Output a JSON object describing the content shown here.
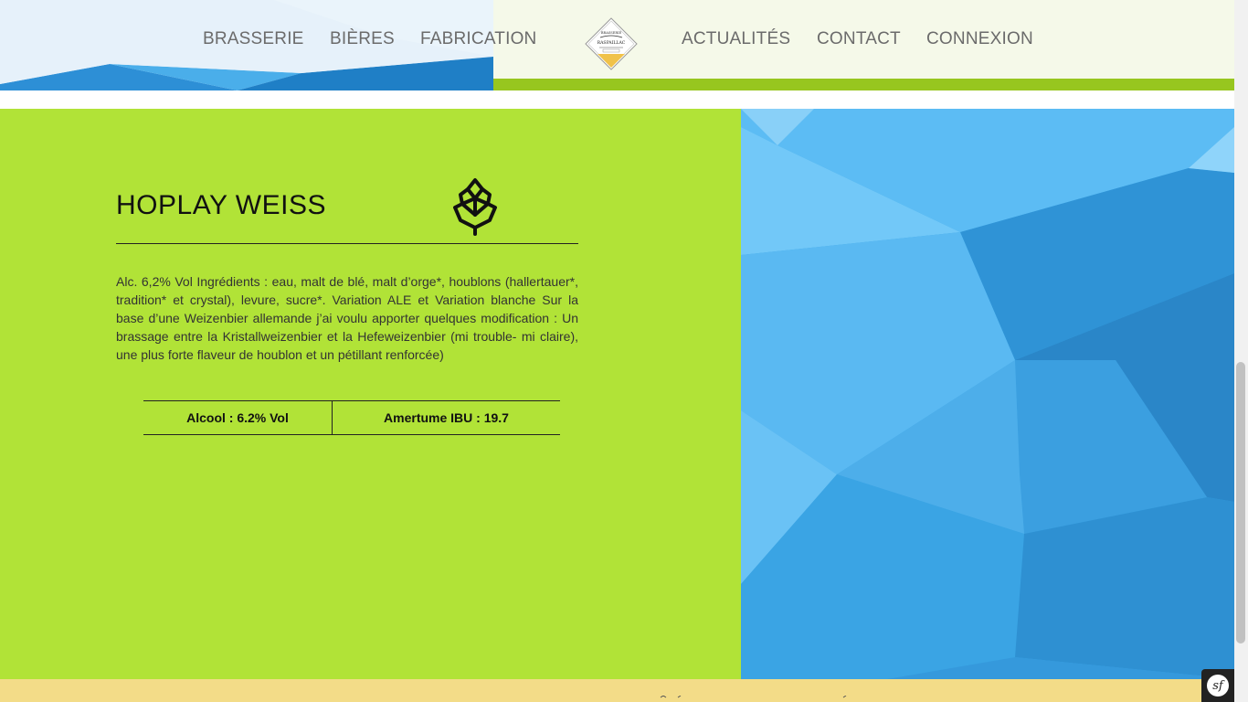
{
  "nav": {
    "left": [
      {
        "label": "BRASSERIE"
      },
      {
        "label": "BIÈRES"
      },
      {
        "label": "FABRICATION"
      }
    ],
    "right": [
      {
        "label": "ACTUALITÉS"
      },
      {
        "label": "CONTACT"
      },
      {
        "label": "CONNEXION"
      }
    ],
    "logo": {
      "line1": "BRASSERIE",
      "line2": "RASPAILLAC"
    }
  },
  "beer": {
    "name": "HOPLAY WEISS",
    "icon": "hop-icon",
    "description": "Alc. 6,2% Vol Ingrédients : eau, malt de blé, malt d’orge*, houblons (hallertauer*, tradition* et crystal), levure, sucre*. Variation ALE et Variation blanche Sur la base d’une Weizenbier allemande j’ai voulu apporter quelques modification : Un brassage entre la Kristallweizenbier et la Hefeweizenbier (mi trouble- mi claire), une plus forte flaveur de houblon et un pétillant renforcée)",
    "stats": {
      "alcohol": "Alcool : 6.2% Vol",
      "bitterness": "Amertume IBU : 19.7"
    }
  },
  "colors": {
    "green_panel": "#b1e337",
    "blue_panel": "#3aa6e6",
    "accent_strip": "#97c61f",
    "footer": "#f3dc88"
  },
  "debug_toolbar": {
    "icon": "symfony-icon",
    "glyph": "sf"
  }
}
